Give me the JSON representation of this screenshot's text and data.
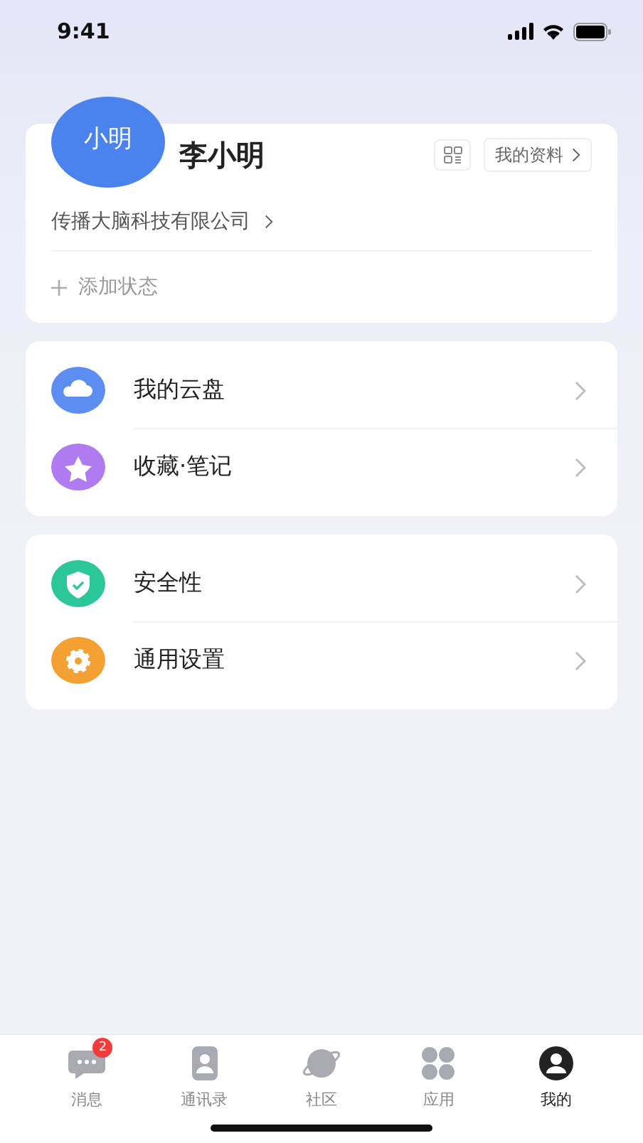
{
  "status_bar": {
    "time": "9:41"
  },
  "profile": {
    "avatar_text": "小明",
    "name": "李小明",
    "profile_button": "我的资料",
    "company": "传播大脑科技有限公司",
    "add_status": "添加状态"
  },
  "menu_groups": [
    [
      {
        "kind": "cloud",
        "label": "我的云盘",
        "color": "#5b8ef0"
      },
      {
        "kind": "star",
        "label": "收藏·笔记",
        "color": "#b07af0"
      }
    ],
    [
      {
        "kind": "shield",
        "label": "安全性",
        "color": "#2bc69a"
      },
      {
        "kind": "gear",
        "label": "通用设置",
        "color": "#f5a033"
      }
    ]
  ],
  "tab_bar": [
    {
      "kind": "chat",
      "label": "消息",
      "badge": "2",
      "selected": false
    },
    {
      "kind": "contacts",
      "label": "通讯录",
      "selected": false
    },
    {
      "kind": "planet",
      "label": "社区",
      "selected": false
    },
    {
      "kind": "apps",
      "label": "应用",
      "selected": false
    },
    {
      "kind": "me",
      "label": "我的",
      "selected": true
    }
  ]
}
